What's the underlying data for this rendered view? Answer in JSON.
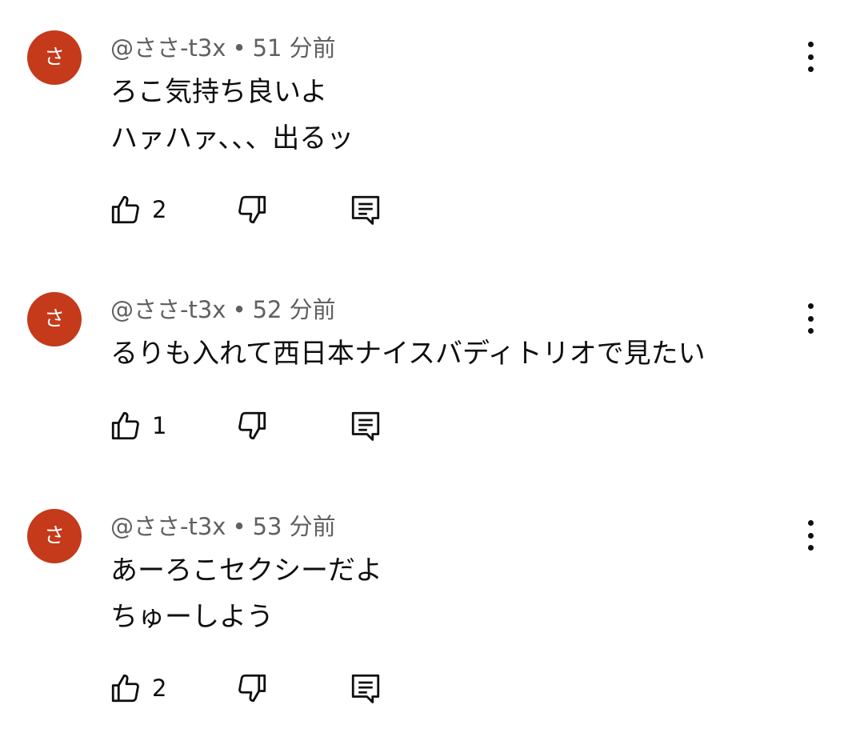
{
  "comments": [
    {
      "avatar_letter": "さ",
      "author": "@ささ-t3x",
      "separator": "•",
      "time": "51 分前",
      "lines": [
        "ろこ気持ち良いよ",
        "ハァハァ、、、出るッ"
      ],
      "likes": "2"
    },
    {
      "avatar_letter": "さ",
      "author": "@ささ-t3x",
      "separator": "•",
      "time": "52 分前",
      "lines": [
        "るりも入れて西日本ナイスバディトリオで見たい"
      ],
      "likes": "1"
    },
    {
      "avatar_letter": "さ",
      "author": "@ささ-t3x",
      "separator": "•",
      "time": "53 分前",
      "lines": [
        "あーろこセクシーだよ",
        "ちゅーしよう"
      ],
      "likes": "2"
    }
  ],
  "icons": {
    "like": "thumbs-up-icon",
    "dislike": "thumbs-down-icon",
    "reply": "reply-comment-icon",
    "menu": "more-vert-icon"
  },
  "colors": {
    "avatar": "#c43a1a",
    "meta_text": "#606060",
    "text": "#0f0f0f",
    "background": "#ffffff"
  }
}
